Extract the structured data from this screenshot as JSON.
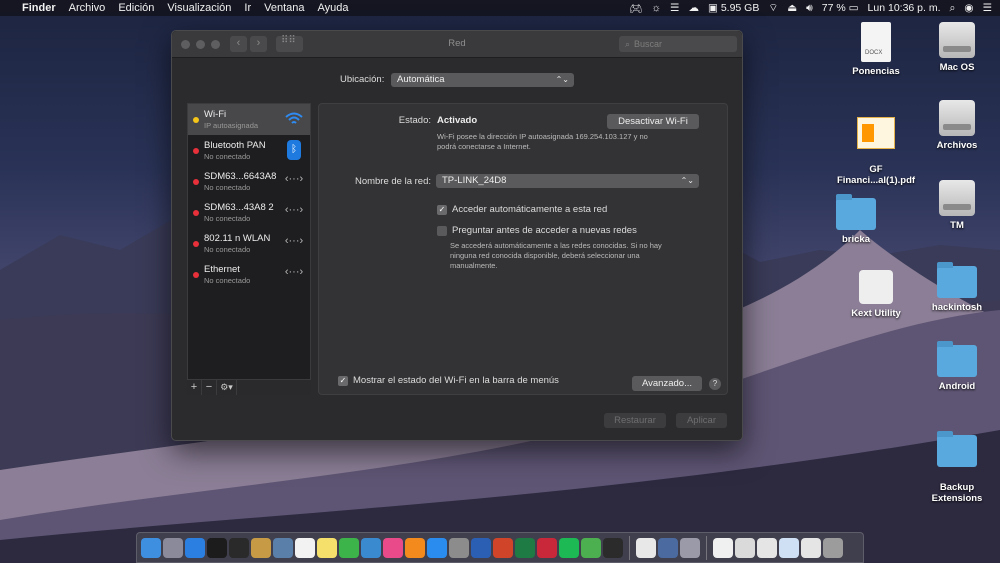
{
  "menubar": {
    "apple": "",
    "app": "Finder",
    "items": [
      "Archivo",
      "Edición",
      "Visualización",
      "Ir",
      "Ventana",
      "Ayuda"
    ],
    "disk": "5.95 GB",
    "battery": "77 %",
    "clock": "Lun 10:36 p. m."
  },
  "desktop": {
    "icons": [
      {
        "label": "Ponencias",
        "type": "docx",
        "tag": "DOCX"
      },
      {
        "label": "Mac OS",
        "type": "drive"
      },
      {
        "label": "GF\nFinanci...al(1).pdf",
        "type": "pdf"
      },
      {
        "label": "Archivos",
        "type": "drive"
      },
      {
        "label": "bricka",
        "type": "folder"
      },
      {
        "label": "TM",
        "type": "drive"
      },
      {
        "label": "Kext Utility",
        "type": "app"
      },
      {
        "label": "hackintosh",
        "type": "folder"
      },
      {
        "label": "Android",
        "type": "folder"
      },
      {
        "label": "Backup\nExtensions",
        "type": "folder"
      }
    ]
  },
  "window": {
    "title": "Red",
    "search_placeholder": "Buscar",
    "location_label": "Ubicación:",
    "location_value": "Automática",
    "services": [
      {
        "name": "Wi-Fi",
        "status": "IP autoasignada",
        "dot": "#f5c518",
        "icon": "wifi-icon",
        "selected": true
      },
      {
        "name": "Bluetooth PAN",
        "status": "No conectado",
        "dot": "#e8303a",
        "icon": "bluetooth-icon"
      },
      {
        "name": "SDM63...6643A8",
        "status": "No conectado",
        "dot": "#e8303a",
        "icon": "network-arrows-icon"
      },
      {
        "name": "SDM63...43A8 2",
        "status": "No conectado",
        "dot": "#e8303a",
        "icon": "network-arrows-icon"
      },
      {
        "name": "802.11 n WLAN",
        "status": "No conectado",
        "dot": "#e8303a",
        "icon": "network-arrows-icon"
      },
      {
        "name": "Ethernet",
        "status": "No conectado",
        "dot": "#e8303a",
        "icon": "network-arrows-icon"
      }
    ],
    "footer": {
      "add": "+",
      "remove": "−",
      "gear": "⚙▾"
    },
    "detail": {
      "status_label": "Estado:",
      "status_value": "Activado",
      "toggle_button": "Desactivar Wi-Fi",
      "status_desc_1": "Wi-Fi posee la dirección IP autoasignada 169.254.103.127 y no",
      "status_desc_2": "podrá conectarse a Internet.",
      "network_label": "Nombre de la red:",
      "network_value": "TP-LINK_24D8",
      "auto_join_label": "Acceder automáticamente a esta red",
      "auto_join_checked": true,
      "ask_label": "Preguntar antes de acceder a nuevas redes",
      "ask_checked": false,
      "ask_desc_1": "Se accederá automáticamente a las redes conocidas. Si no hay",
      "ask_desc_2": "ninguna red conocida disponible, deberá seleccionar una",
      "ask_desc_3": "manualmente.",
      "show_status_label": "Mostrar el estado del Wi-Fi en la barra de menús",
      "show_status_checked": true,
      "advanced_button": "Avanzado...",
      "help": "?"
    },
    "buttons": {
      "revert": "Restaurar",
      "apply": "Aplicar"
    }
  },
  "colors": {
    "accent": "#1f7ae0",
    "dot_yellow": "#f5c518",
    "dot_red": "#e8303a"
  },
  "dock": {
    "items": [
      {
        "name": "finder-icon",
        "color": "#3f8fe0"
      },
      {
        "name": "launchpad-icon",
        "color": "#8a8a9a"
      },
      {
        "name": "safari-icon",
        "color": "#2a7fe0"
      },
      {
        "name": "terminal-icon",
        "color": "#1c1c1c"
      },
      {
        "name": "activity-monitor-icon",
        "color": "#2a2a2a"
      },
      {
        "name": "package-icon",
        "color": "#c79a45"
      },
      {
        "name": "preview-icon",
        "color": "#5a7fa8"
      },
      {
        "name": "calendar-icon",
        "color": "#f2f2f2"
      },
      {
        "name": "notes-icon",
        "color": "#f4e06a"
      },
      {
        "name": "facetime-icon",
        "color": "#3cb44a"
      },
      {
        "name": "network-utility-icon",
        "color": "#3a8ad0"
      },
      {
        "name": "itunes-icon",
        "color": "#e84a8a"
      },
      {
        "name": "books-icon",
        "color": "#f28a1e"
      },
      {
        "name": "app-store-icon",
        "color": "#2b8cf0"
      },
      {
        "name": "system-preferences-icon",
        "color": "#8c8c8c"
      },
      {
        "name": "word-icon",
        "color": "#2b5fb4"
      },
      {
        "name": "powerpoint-icon",
        "color": "#d0442a"
      },
      {
        "name": "excel-icon",
        "color": "#1e7b43"
      },
      {
        "name": "photo-booth-icon",
        "color": "#c8283a"
      },
      {
        "name": "spotify-icon",
        "color": "#1db954"
      },
      {
        "name": "utorrent-icon",
        "color": "#4caf50"
      },
      {
        "name": "pycharm-icon",
        "color": "#2b2b2b"
      },
      {
        "name": "sep",
        "color": ""
      },
      {
        "name": "textedit-icon",
        "color": "#e8e8e8"
      },
      {
        "name": "video-icon",
        "color": "#4a6aa0"
      },
      {
        "name": "keychain-icon",
        "color": "#9a9aa8"
      },
      {
        "name": "sep",
        "color": ""
      },
      {
        "name": "document-icon",
        "color": "#f0f0f0"
      },
      {
        "name": "document-icon",
        "color": "#dadada"
      },
      {
        "name": "document-icon",
        "color": "#e5e5e5"
      },
      {
        "name": "document-icon",
        "color": "#cfe0f5"
      },
      {
        "name": "document-icon",
        "color": "#e5e5e5"
      },
      {
        "name": "trash-icon",
        "color": "#9c9c9c"
      }
    ]
  }
}
